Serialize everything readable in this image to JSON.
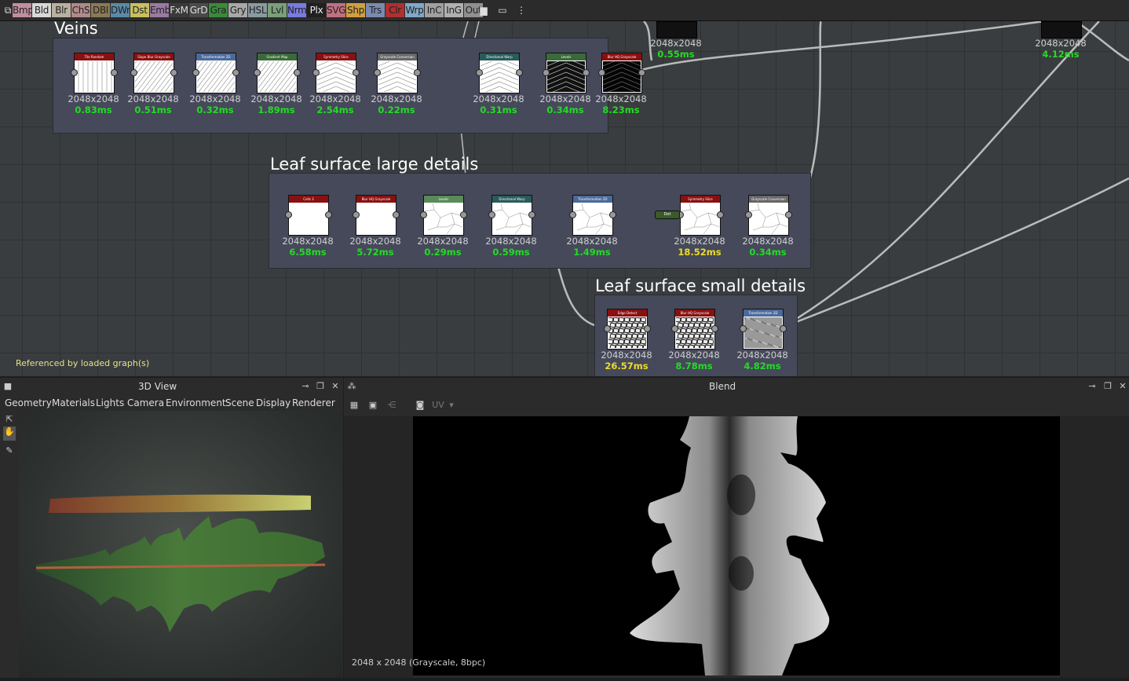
{
  "toolbar": {
    "items": [
      {
        "label": "Bmp",
        "bg": "#c08ea0"
      },
      {
        "label": "Bld",
        "bg": "#d8d8d8"
      },
      {
        "label": "Blr",
        "bg": "#b9b0a0"
      },
      {
        "label": "ChS",
        "bg": "#b08a8a"
      },
      {
        "label": "DBl",
        "bg": "#8a7a55"
      },
      {
        "label": "DWr",
        "bg": "#5a8aa8"
      },
      {
        "label": "Dst",
        "bg": "#c8c060"
      },
      {
        "label": "Emb",
        "bg": "#9a7aa0"
      },
      {
        "label": "FxM",
        "bg": "#3a3a3a",
        "fg": "#ddd"
      },
      {
        "label": "GrD",
        "bg": "#4a4a4a",
        "fg": "#ddd"
      },
      {
        "label": "Gra",
        "bg": "#3a8a3a"
      },
      {
        "label": "Gry",
        "bg": "#a8a8a8"
      },
      {
        "label": "HSL",
        "bg": "#8a9aa0"
      },
      {
        "label": "Lvl",
        "bg": "#7aa07a"
      },
      {
        "label": "Nrm",
        "bg": "#7a7ae0"
      },
      {
        "label": "Plx",
        "bg": "#202020",
        "fg": "#eee"
      },
      {
        "label": "SVG",
        "bg": "#c07080"
      },
      {
        "label": "Shp",
        "bg": "#d0a040"
      },
      {
        "label": "Trs",
        "bg": "#7a8ab0"
      },
      {
        "label": "Clr",
        "bg": "#b03030"
      },
      {
        "label": "Wrp",
        "bg": "#80a8c8"
      },
      {
        "label": "InC",
        "bg": "#a0a0a0"
      },
      {
        "label": "InG",
        "bg": "#b0b0b0"
      },
      {
        "label": "Out",
        "bg": "#909090"
      }
    ],
    "icons": [
      "comment-icon",
      "frame-icon",
      "info-icon"
    ]
  },
  "graph": {
    "frames": [
      {
        "title": "Veins",
        "nodes": [
          {
            "name": "Tile Random",
            "hdr": "#8a1010",
            "res": "2048x2048",
            "ms": "0.83ms",
            "tex": "stripes"
          },
          {
            "name": "Slope Blur Grayscale",
            "hdr": "#8a1010",
            "res": "2048x2048",
            "ms": "0.51ms",
            "tex": "diag"
          },
          {
            "name": "Transformation 2D",
            "hdr": "#4a6a9a",
            "res": "2048x2048",
            "ms": "0.32ms",
            "tex": "diag"
          },
          {
            "name": "Gradient Map",
            "hdr": "#3a6a3a",
            "res": "2048x2048",
            "ms": "1.89ms",
            "tex": "diag"
          },
          {
            "name": "Symmetry Slice",
            "hdr": "#8a1010",
            "res": "2048x2048",
            "ms": "2.54ms",
            "tex": "chev"
          },
          {
            "name": "Grayscale Conversion",
            "hdr": "#666",
            "res": "2048x2048",
            "ms": "0.22ms",
            "tex": "chev"
          },
          {
            "name": "Directional Warp",
            "hdr": "#2a5a5a",
            "res": "2048x2048",
            "ms": "0.31ms",
            "tex": "chev"
          },
          {
            "name": "Levels",
            "hdr": "#3a6a3a",
            "res": "2048x2048",
            "ms": "0.34ms",
            "tex": "dark"
          },
          {
            "name": "Blur HQ Grayscale",
            "hdr": "#8a1010",
            "res": "2048x2048",
            "ms": "8.23ms",
            "tex": "darker"
          }
        ]
      },
      {
        "title": "Leaf surface large details",
        "nodes": [
          {
            "name": "Cells 3",
            "hdr": "#8a1010",
            "res": "2048x2048",
            "ms": "6.58ms",
            "tex": "white"
          },
          {
            "name": "Blur HQ Grayscale",
            "hdr": "#8a1010",
            "res": "2048x2048",
            "ms": "5.72ms",
            "tex": "white"
          },
          {
            "name": "Levels",
            "hdr": "#5a8a5a",
            "res": "2048x2048",
            "ms": "0.29ms",
            "tex": "cells"
          },
          {
            "name": "Directional Warp",
            "hdr": "#2a5a5a",
            "res": "2048x2048",
            "ms": "0.59ms",
            "tex": "cells"
          },
          {
            "name": "Transformation 2D",
            "hdr": "#4a6a9a",
            "res": "2048x2048",
            "ms": "1.49ms",
            "tex": "cells"
          },
          {
            "name": "Symmetry Slice",
            "hdr": "#8a1010",
            "res": "2048x2048",
            "ms": "18.52ms",
            "tex": "cells",
            "warn": true
          },
          {
            "name": "Grayscale Conversion",
            "hdr": "#666",
            "res": "2048x2048",
            "ms": "0.34ms",
            "tex": "cells"
          }
        ],
        "dot_label": "Dot"
      },
      {
        "title": "Leaf surface small details",
        "nodes": [
          {
            "name": "Edge Detect",
            "hdr": "#8a1010",
            "res": "2048x2048",
            "ms": "26.57ms",
            "tex": "mosaic",
            "warn": true
          },
          {
            "name": "Blur HQ Grayscale",
            "hdr": "#8a1010",
            "res": "2048x2048",
            "ms": "8.78ms",
            "tex": "mosaic"
          },
          {
            "name": "Transformation 2D",
            "hdr": "#4a6a9a",
            "res": "2048x2048",
            "ms": "4.82ms",
            "tex": "noise"
          }
        ]
      }
    ],
    "offscreen_nodes": [
      {
        "res": "2048x2048",
        "ms": "0.55ms"
      },
      {
        "res": "2048x2048",
        "ms": "4.12ms"
      }
    ],
    "ref_note": "Referenced by loaded graph(s)"
  },
  "panel_3d": {
    "title": "3D View",
    "menu": [
      "Geometry",
      "Materials",
      "Lights",
      "Camera",
      "Environment",
      "Scene",
      "Display",
      "Renderer"
    ]
  },
  "panel_blend": {
    "title": "Blend",
    "uv_label": "UV",
    "status": "2048 x 2048 (Grayscale, 8bpc)"
  },
  "colors": {
    "ms_ok": "#22dd22",
    "ms_warn": "#eedd22"
  }
}
